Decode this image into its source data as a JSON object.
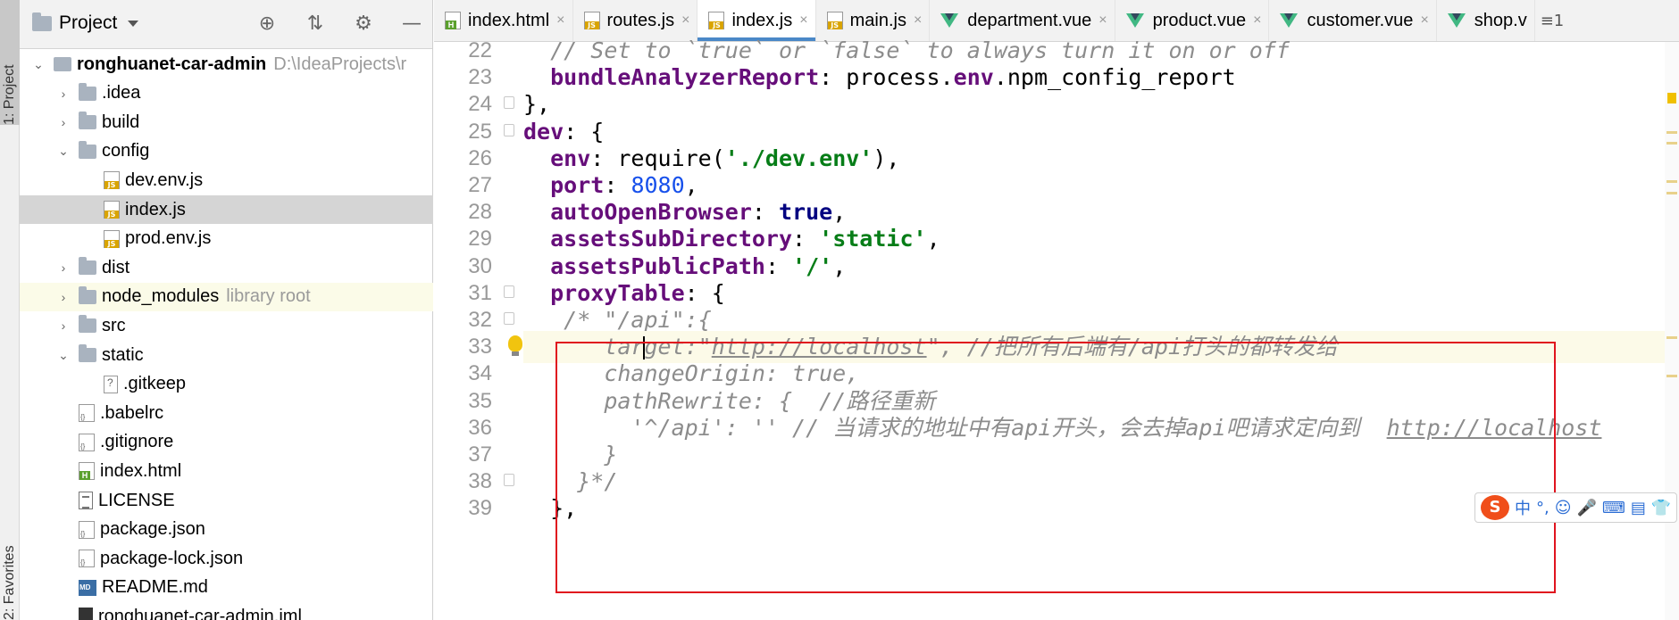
{
  "side_tabs": {
    "project": "1: Project",
    "favorites": "2: Favorites"
  },
  "project_panel": {
    "title": "Project",
    "tree": [
      {
        "name": "ronghuanet-car-admin",
        "hint": "D:\\IdeaProjects\\r",
        "type": "root",
        "arrow": "down",
        "depth": 0,
        "bold": true
      },
      {
        "name": ".idea",
        "type": "folder",
        "arrow": "right",
        "depth": 1
      },
      {
        "name": "build",
        "type": "folder",
        "arrow": "right",
        "depth": 1
      },
      {
        "name": "config",
        "type": "folder",
        "arrow": "down",
        "depth": 1
      },
      {
        "name": "dev.env.js",
        "type": "js",
        "depth": 2
      },
      {
        "name": "index.js",
        "type": "js",
        "depth": 2,
        "selected": true
      },
      {
        "name": "prod.env.js",
        "type": "js",
        "depth": 2
      },
      {
        "name": "dist",
        "type": "folder",
        "arrow": "right",
        "depth": 1
      },
      {
        "name": "node_modules",
        "hint": "library root",
        "type": "folder",
        "arrow": "right",
        "depth": 1,
        "libroot": true
      },
      {
        "name": "src",
        "type": "folder",
        "arrow": "right",
        "depth": 1
      },
      {
        "name": "static",
        "type": "folder",
        "arrow": "down",
        "depth": 1
      },
      {
        "name": ".gitkeep",
        "type": "unknown",
        "depth": 2
      },
      {
        "name": ".babelrc",
        "type": "cfg",
        "depth": 1
      },
      {
        "name": ".gitignore",
        "type": "cfg",
        "depth": 1
      },
      {
        "name": "index.html",
        "type": "html",
        "depth": 1
      },
      {
        "name": "LICENSE",
        "type": "text",
        "depth": 1
      },
      {
        "name": "package.json",
        "type": "cfg",
        "depth": 1
      },
      {
        "name": "package-lock.json",
        "type": "cfg",
        "depth": 1
      },
      {
        "name": "README.md",
        "type": "md",
        "depth": 1
      },
      {
        "name": "ronghuanet-car-admin.iml",
        "type": "iml",
        "depth": 1
      }
    ]
  },
  "editor": {
    "tabs": [
      {
        "label": "index.html",
        "icon": "html"
      },
      {
        "label": "routes.js",
        "icon": "js"
      },
      {
        "label": "index.js",
        "icon": "js",
        "active": true
      },
      {
        "label": "main.js",
        "icon": "js"
      },
      {
        "label": "department.vue",
        "icon": "vue"
      },
      {
        "label": "product.vue",
        "icon": "vue"
      },
      {
        "label": "customer.vue",
        "icon": "vue"
      },
      {
        "label": "shop.v",
        "icon": "vue",
        "noclose": true
      }
    ],
    "tab_overflow": "≡1",
    "lines": [
      {
        "n": "22",
        "indent": "  ",
        "tokens": [
          [
            "cmt",
            "// Set to `true` or `false` to always turn it on or off"
          ]
        ]
      },
      {
        "n": "23",
        "indent": "  ",
        "tokens": [
          [
            "key",
            "bundleAnalyzerReport"
          ],
          [
            "plain",
            ": process."
          ],
          [
            "key",
            "env"
          ],
          [
            "plain",
            ".npm_config_report"
          ]
        ]
      },
      {
        "n": "24",
        "indent": "",
        "fold": true,
        "tokens": [
          [
            "plain",
            "},"
          ]
        ]
      },
      {
        "n": "25",
        "indent": "",
        "fold": true,
        "tokens": [
          [
            "key",
            "dev"
          ],
          [
            "plain",
            ": {"
          ]
        ]
      },
      {
        "n": "26",
        "indent": "  ",
        "tokens": [
          [
            "key",
            "env"
          ],
          [
            "plain",
            ": require("
          ],
          [
            "str",
            "'./dev.env'"
          ],
          [
            "plain",
            "),"
          ]
        ]
      },
      {
        "n": "27",
        "indent": "  ",
        "tokens": [
          [
            "key",
            "port"
          ],
          [
            "plain",
            ": "
          ],
          [
            "num",
            "8080"
          ],
          [
            "plain",
            ","
          ]
        ]
      },
      {
        "n": "28",
        "indent": "  ",
        "tokens": [
          [
            "key",
            "autoOpenBrowser"
          ],
          [
            "plain",
            ": "
          ],
          [
            "kw",
            "true"
          ],
          [
            "plain",
            ","
          ]
        ]
      },
      {
        "n": "29",
        "indent": "  ",
        "tokens": [
          [
            "key",
            "assetsSubDirectory"
          ],
          [
            "plain",
            ": "
          ],
          [
            "str",
            "'static'"
          ],
          [
            "plain",
            ","
          ]
        ]
      },
      {
        "n": "30",
        "indent": "  ",
        "tokens": [
          [
            "key",
            "assetsPublicPath"
          ],
          [
            "plain",
            ": "
          ],
          [
            "str",
            "'/'"
          ],
          [
            "plain",
            ","
          ]
        ]
      },
      {
        "n": "31",
        "indent": "  ",
        "fold": true,
        "tokens": [
          [
            "key",
            "proxyTable"
          ],
          [
            "plain",
            ": {"
          ]
        ]
      },
      {
        "n": "32",
        "indent": "   ",
        "fold": true,
        "tokens": [
          [
            "cmt",
            "/* \"/api\":{"
          ]
        ]
      },
      {
        "n": "33",
        "indent": "      ",
        "current": true,
        "bulb": true,
        "tokens": [
          [
            "cmt",
            "tar"
          ],
          [
            "caret",
            ""
          ],
          [
            "cmt",
            "get:\""
          ],
          [
            "url",
            "http://localhost"
          ],
          [
            "cmt",
            "\", //把所有后端有/api打头的都转发给"
          ]
        ]
      },
      {
        "n": "34",
        "indent": "      ",
        "tokens": [
          [
            "cmt",
            "changeOrigin: true,"
          ]
        ]
      },
      {
        "n": "35",
        "indent": "      ",
        "tokens": [
          [
            "cmt",
            "pathRewrite: {  //路径重新"
          ]
        ]
      },
      {
        "n": "36",
        "indent": "        ",
        "tokens": [
          [
            "cmt",
            "'^/api': '' // 当请求的地址中有api开头，会去掉api吧请求定向到  "
          ],
          [
            "url",
            "http://localhost"
          ]
        ]
      },
      {
        "n": "37",
        "indent": "      ",
        "tokens": [
          [
            "cmt",
            "}"
          ]
        ]
      },
      {
        "n": "38",
        "indent": "    ",
        "fold": true,
        "tokens": [
          [
            "cmt",
            "}*/"
          ]
        ]
      },
      {
        "n": "39",
        "indent": "  ",
        "tokens": [
          [
            "plain",
            "},"
          ]
        ]
      }
    ]
  },
  "ime_toolbar": {
    "logo": "S",
    "items": [
      "中",
      "°,",
      "☺",
      "🎤",
      "⌨",
      "▤",
      "👕"
    ]
  },
  "colors": {
    "annotation_box": "#e0141e",
    "active_tab_underline": "#4a88c7",
    "keyword_purple": "#660e7a",
    "string_green": "#067d17"
  }
}
